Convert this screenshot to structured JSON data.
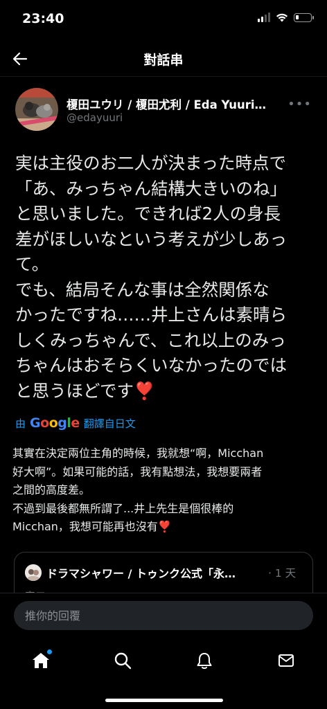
{
  "status_bar": {
    "time": "23:40",
    "battery_level": 0.2
  },
  "nav": {
    "title": "對話串"
  },
  "tweet": {
    "author_name": "榎田ユウリ / 榎田尤利 / Eda Yuuri…",
    "author_handle": "@edayuuri",
    "body_lines": [
      "実は主役のお二人が決まった時点で",
      "「あ、みっちゃん結構大きいのね」",
      "と思いました。できれば2人の身長",
      "差がほしいなという考えが少しあっ",
      "て。",
      "でも、結局そんな事は全然関係な",
      "かったですね……井上さんは素晴ら",
      "しくみっちゃんで、これ以上のみっ",
      "ちゃんはおそらくいなかったのでは",
      "と思うほどです❣️"
    ],
    "translate": {
      "prefix": "由",
      "google": "Google",
      "suffix": "翻譯自日文"
    },
    "translated_lines": [
      "其實在決定兩位主角的時候，我就想“啊，Micchan",
      "好大啊”。如果可能的話，我有點想法，我想要兩者",
      "之間的高度差。",
      "不過到最後都無所謂了...井上先生是個很棒的",
      "Micchan，我想可能再也沒有❣️"
    ],
    "quote": {
      "author": "ドラマシャワー / トゥンク公式「永…",
      "time": "· 1 天",
      "second_line": "宣二"
    }
  },
  "reply": {
    "placeholder": "推你的回覆"
  },
  "tabs": [
    {
      "name": "home",
      "icon": "home-icon",
      "has_dot": true
    },
    {
      "name": "search",
      "icon": "search-icon"
    },
    {
      "name": "notifications",
      "icon": "bell-icon"
    },
    {
      "name": "messages",
      "icon": "mail-icon"
    }
  ],
  "colors": {
    "accent": "#1d9bf0",
    "background": "#000000",
    "muted": "#71767b"
  }
}
